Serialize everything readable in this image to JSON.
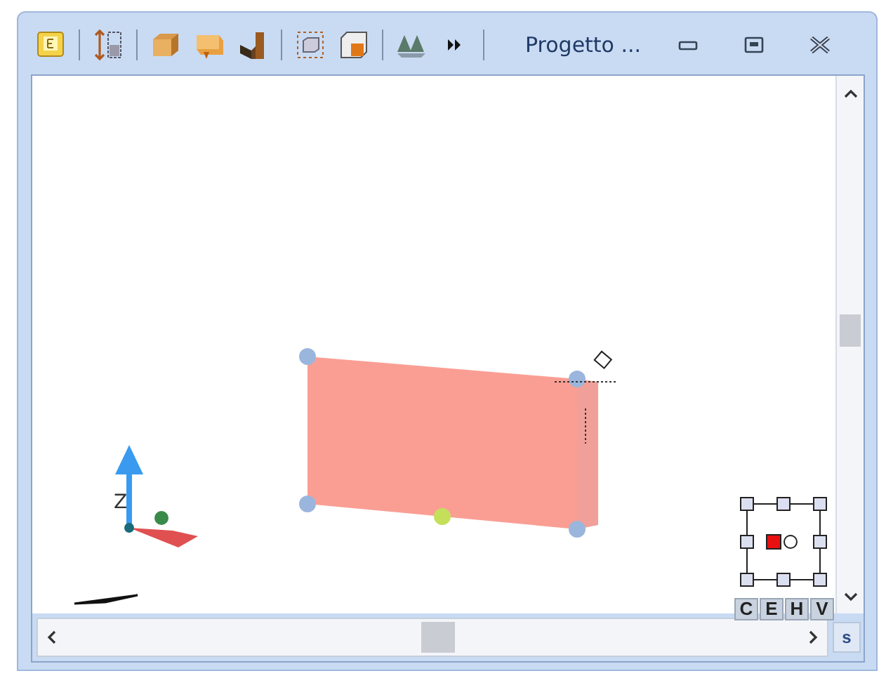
{
  "window": {
    "title": "Progetto ..."
  },
  "viewport": {
    "axis_label": "Z",
    "view_buttons": [
      "C",
      "E",
      "H",
      "V"
    ]
  },
  "scrollbars": {
    "corner_button": "s"
  }
}
